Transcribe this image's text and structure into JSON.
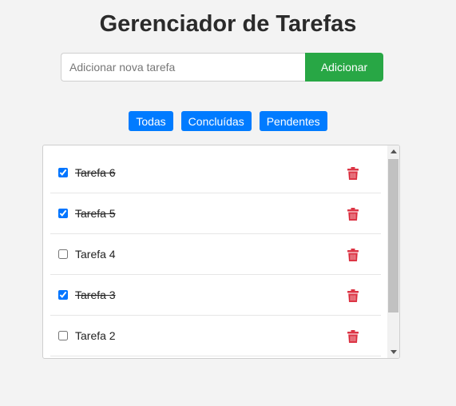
{
  "header": {
    "title": "Gerenciador de Tarefas"
  },
  "add_form": {
    "placeholder": "Adicionar nova tarefa",
    "value": "",
    "button_label": "Adicionar"
  },
  "filters": [
    {
      "label": "Todas"
    },
    {
      "label": "Concluídas"
    },
    {
      "label": "Pendentes"
    }
  ],
  "tasks": [
    {
      "label": "Tarefa 6",
      "done": true,
      "delete_icon": "trash-icon"
    },
    {
      "label": "Tarefa 5",
      "done": true,
      "delete_icon": "trash-icon"
    },
    {
      "label": "Tarefa 4",
      "done": false,
      "delete_icon": "trash-icon"
    },
    {
      "label": "Tarefa 3",
      "done": true,
      "delete_icon": "trash-icon"
    },
    {
      "label": "Tarefa 2",
      "done": false,
      "delete_icon": "trash-icon"
    }
  ],
  "colors": {
    "add_button": "#28a745",
    "filter_button": "#007bff",
    "delete_icon": "#dc3545",
    "background": "#f3f3f3"
  }
}
